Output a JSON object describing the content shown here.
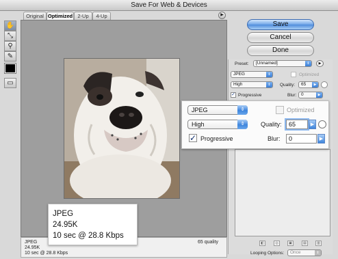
{
  "window": {
    "title": "Save For Web & Devices"
  },
  "tabs": [
    {
      "label": "Original",
      "active": false
    },
    {
      "label": "Optimized",
      "active": true
    },
    {
      "label": "2-Up",
      "active": false
    },
    {
      "label": "4-Up",
      "active": false
    }
  ],
  "tools": [
    {
      "name": "hand-tool-icon",
      "glyph": "✋",
      "active": true
    },
    {
      "name": "slice-select-tool-icon",
      "glyph": "⤡",
      "active": false
    },
    {
      "name": "zoom-tool-icon",
      "glyph": "⚲",
      "active": false
    },
    {
      "name": "eyedropper-tool-icon",
      "glyph": "✎",
      "active": false
    },
    {
      "name": "toggle-slices-icon",
      "glyph": "▭",
      "active": false
    }
  ],
  "eyedropper_color": "#000000",
  "status": {
    "format": "JPEG",
    "size": "24.95K",
    "time": "10 sec @ 28.8 Kbps",
    "quality": "65 quality"
  },
  "buttons": {
    "save": "Save",
    "cancel": "Cancel",
    "done": "Done"
  },
  "settings": {
    "preset_label": "Preset:",
    "preset_value": "[Unnamed]",
    "format": "JPEG",
    "optimized_label": "Optimized",
    "optimized_checked": false,
    "compression": "High",
    "quality_label": "Quality:",
    "quality_value": "65",
    "progressive_label": "Progressive",
    "progressive_checked": true,
    "blur_label": "Blur:",
    "blur_value": "0"
  },
  "looping": {
    "label": "Looping Options:",
    "value": "Once"
  },
  "colors": {
    "accent": "#3f86dd",
    "preview_bg": "#9e9e9e"
  }
}
